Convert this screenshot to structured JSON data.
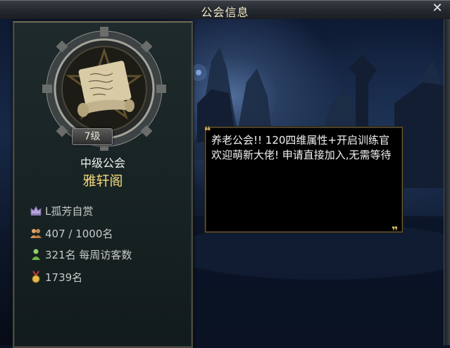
{
  "window": {
    "title": "公会信息",
    "close_icon": "close-icon"
  },
  "guild": {
    "level": "7级",
    "rank": "中级公会",
    "name": "雅轩阁",
    "leader": "L孤芳自赏",
    "members": "407 / 1000名",
    "weekly_visitors": "321名 每周访客数",
    "ranking": "1739名",
    "emblem_icon": "scroll-emblem-icon"
  },
  "notice": {
    "text": "养老公会!! 120四维属性+开启训练官 欢迎萌新大佬! 申请直接加入,无需等待"
  },
  "colors": {
    "guild_name": "#f2d87a",
    "quote_marks": "#d7b864",
    "title_text": "#f2e8c6"
  },
  "icons": {
    "leader": "crown-icon",
    "members": "people-icon",
    "visitors": "person-icon",
    "ranking": "medal-icon"
  }
}
